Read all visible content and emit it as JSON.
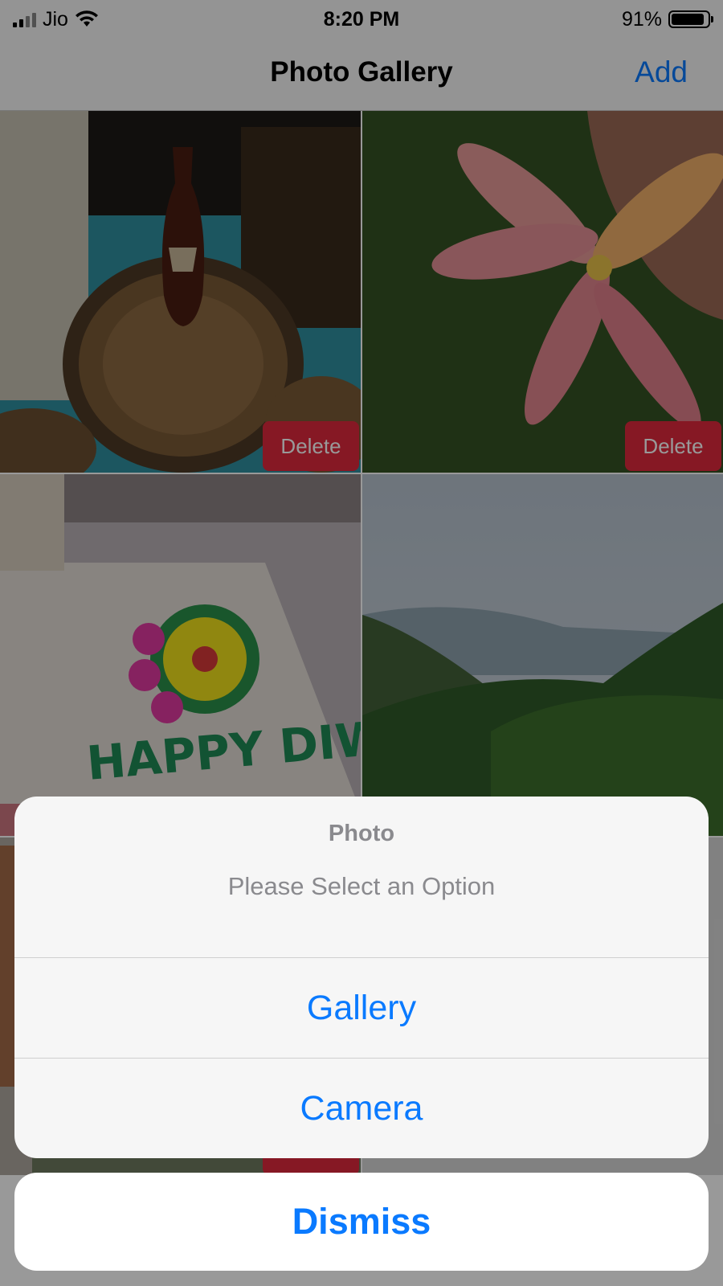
{
  "status_bar": {
    "carrier": "Jio",
    "time": "8:20 PM",
    "battery": "91%",
    "battery_level": 0.91
  },
  "nav": {
    "title": "Photo Gallery",
    "add_label": "Add"
  },
  "gallery": {
    "delete_label": "Delete",
    "photos": [
      "vase-on-carved-table-photo",
      "pink-flower-photo",
      "diwali-rangoli-photo",
      "forest-hills-photo",
      "building-photo",
      "garden-photo"
    ]
  },
  "action_sheet": {
    "title": "Photo",
    "message": "Please Select an Option",
    "actions": [
      "Gallery",
      "Camera"
    ],
    "cancel_label": "Dismiss"
  },
  "colors": {
    "accent": "#0a7aff",
    "delete": "#e0283d",
    "sheet_bg": "#f6f6f6"
  }
}
